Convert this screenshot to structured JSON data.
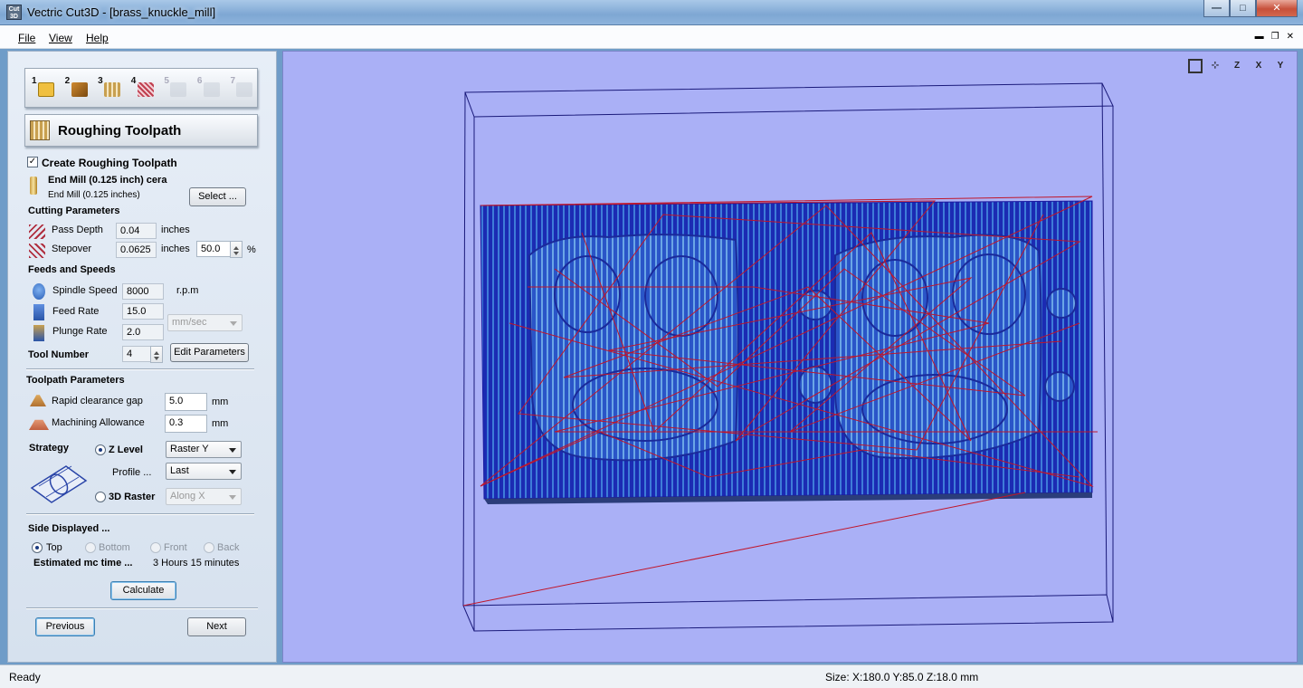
{
  "window": {
    "title": "Vectric Cut3D - [brass_knuckle_mill]",
    "app_icon_text": "Cut 3D",
    "minimize": "—",
    "maximize": "□",
    "close": "✕"
  },
  "menu": {
    "file": "File",
    "view": "View",
    "help": "Help"
  },
  "toolbar": {
    "steps": [
      "1",
      "2",
      "3",
      "4",
      "5",
      "6",
      "7"
    ]
  },
  "panel": {
    "title": "Roughing Toolpath",
    "create_toolpath_label": "Create Roughing Toolpath",
    "create_toolpath_checked": true,
    "tool_name_bold": "End Mill (0.125 inch) cera",
    "tool_name": "End Mill (0.125 inches)",
    "select_button": "Select ...",
    "cutting_parameters": {
      "heading": "Cutting Parameters",
      "pass_depth_label": "Pass Depth",
      "pass_depth_value": "0.04",
      "pass_depth_unit": "inches",
      "stepover_label": "Stepover",
      "stepover_value": "0.0625",
      "stepover_unit": "inches",
      "stepover_percent": "50.0",
      "percent_sign": "%"
    },
    "feeds_and_speeds": {
      "heading": "Feeds and Speeds",
      "spindle_label": "Spindle Speed",
      "spindle_value": "8000",
      "spindle_unit": "r.p.m",
      "feed_label": "Feed Rate",
      "feed_value": "15.0",
      "plunge_label": "Plunge Rate",
      "plunge_value": "2.0",
      "rate_unit": "mm/sec"
    },
    "tool_number": {
      "label": "Tool Number",
      "value": "4",
      "edit_button": "Edit Parameters"
    },
    "toolpath_parameters": {
      "heading": "Toolpath Parameters",
      "rapid_label": "Rapid clearance gap",
      "rapid_value": "5.0",
      "rapid_unit": "mm",
      "allowance_label": "Machining Allowance",
      "allowance_value": "0.3",
      "allowance_unit": "mm"
    },
    "strategy": {
      "heading": "Strategy",
      "zlevel_label": "Z Level",
      "zlevel_selected": true,
      "zlevel_option": "Raster Y",
      "profile_label": "Profile ...",
      "profile_option": "Last",
      "raster_label": "3D Raster",
      "raster_selected": false,
      "raster_option": "Along X"
    },
    "side_displayed": {
      "heading": "Side Displayed ...",
      "options": [
        "Top",
        "Bottom",
        "Front",
        "Back"
      ],
      "selected": "Top"
    },
    "estimate": {
      "label": "Estimated mc time ...",
      "value": "3 Hours 15 minutes"
    },
    "calculate_button": "Calculate",
    "previous_button": "Previous",
    "next_button": "Next"
  },
  "viewport": {
    "tools": [
      "fit-view",
      "iso",
      "Z",
      "X",
      "Y"
    ],
    "tool_labels": [
      "",
      "",
      "Z",
      "X",
      "Y"
    ],
    "background": "#aab0f6"
  },
  "status": {
    "left": "Ready",
    "size": "Size: X:180.0 Y:85.0 Z:18.0 mm"
  }
}
